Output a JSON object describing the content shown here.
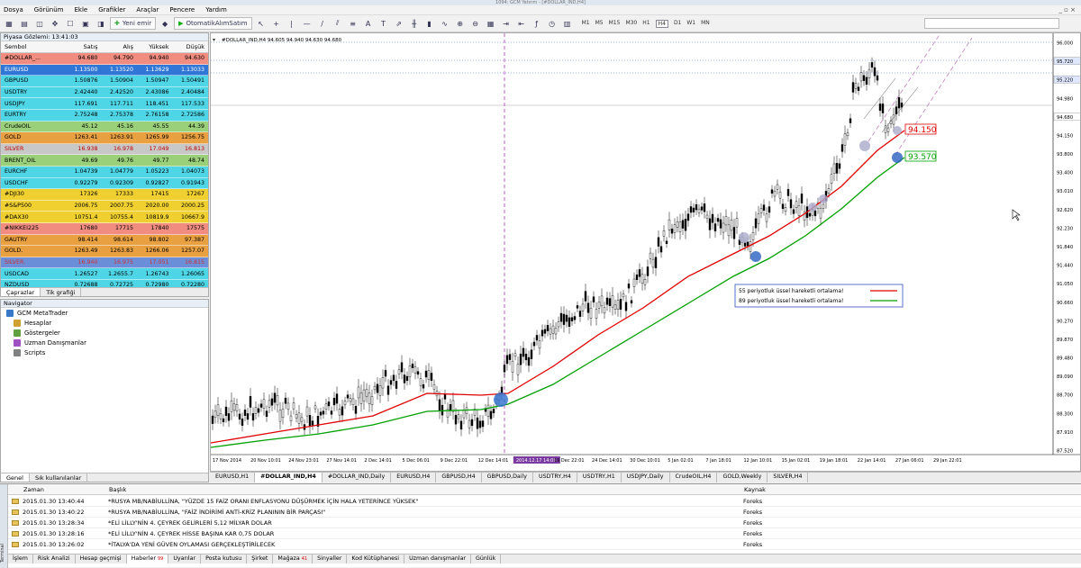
{
  "titlebar": "1094: GCM Yatırım - [#DOLLAR_IND,H4]",
  "menu": [
    "Dosya",
    "Görünüm",
    "Ekle",
    "Grafikler",
    "Araçlar",
    "Pencere",
    "Yardım"
  ],
  "toolbar": {
    "new_order": "Yeni emir",
    "auto_trading": "OtomatikAlımSatım",
    "timeframes": [
      "M1",
      "M5",
      "M15",
      "M30",
      "H1",
      "H4",
      "D1",
      "W1",
      "MN"
    ],
    "selected_tf": "H4"
  },
  "market_watch": {
    "title": "Piyasa Gözlemi: 13:41:03",
    "headers": [
      "Sembol",
      "Satış",
      "Alış",
      "Yüksek",
      "Düşük"
    ],
    "rows": [
      {
        "s": "#DOLLAR_...",
        "bid": "94.680",
        "ask": "94.790",
        "high": "94.940",
        "low": "94.630",
        "bg": "#f08c80"
      },
      {
        "s": "EURUSD",
        "bid": "1.13500",
        "ask": "1.13520",
        "high": "1.13629",
        "low": "1.13033",
        "bg": "#2f76d6",
        "fg": "#fff"
      },
      {
        "s": "GBPUSD",
        "bid": "1.50876",
        "ask": "1.50904",
        "high": "1.50947",
        "low": "1.50491",
        "bg": "#4ed6e6"
      },
      {
        "s": "USDTRY",
        "bid": "2.42440",
        "ask": "2.42520",
        "high": "2.43086",
        "low": "2.40484",
        "bg": "#4ed6e6"
      },
      {
        "s": "USDJPY",
        "bid": "117.691",
        "ask": "117.711",
        "high": "118.451",
        "low": "117.533",
        "bg": "#4ed6e6"
      },
      {
        "s": "EURTRY",
        "bid": "2.75248",
        "ask": "2.75378",
        "high": "2.76158",
        "low": "2.72586",
        "bg": "#4ed6e6"
      },
      {
        "s": "CrudeOIL",
        "bid": "45.12",
        "ask": "45.16",
        "high": "45.55",
        "low": "44.39",
        "bg": "#9ad07a"
      },
      {
        "s": "GOLD",
        "bid": "1263.41",
        "ask": "1263.91",
        "high": "1265.99",
        "low": "1256.75",
        "bg": "#e8a040"
      },
      {
        "s": "SILVER",
        "bid": "16.938",
        "ask": "16.978",
        "high": "17.049",
        "low": "16.813",
        "bg": "#c8c8c8",
        "fg": "#b00"
      },
      {
        "s": "BRENT_OIL",
        "bid": "49.69",
        "ask": "49.76",
        "high": "49.77",
        "low": "48.74",
        "bg": "#9ad07a"
      },
      {
        "s": "EURCHF",
        "bid": "1.04739",
        "ask": "1.04779",
        "high": "1.05223",
        "low": "1.04073",
        "bg": "#4ed6e6"
      },
      {
        "s": "USDCHF",
        "bid": "0.92279",
        "ask": "0.92309",
        "high": "0.92827",
        "low": "0.91943",
        "bg": "#4ed6e6"
      },
      {
        "s": "#DJI30",
        "bid": "17326",
        "ask": "17333",
        "high": "17415",
        "low": "17267",
        "bg": "#f0d030"
      },
      {
        "s": "#S&P500",
        "bid": "2006.75",
        "ask": "2007.75",
        "high": "2020.00",
        "low": "2000.25",
        "bg": "#f0d030"
      },
      {
        "s": "#DAX30",
        "bid": "10751.4",
        "ask": "10755.4",
        "high": "10819.9",
        "low": "10667.9",
        "bg": "#f0d030"
      },
      {
        "s": "#NIKKEI225",
        "bid": "17680",
        "ask": "17715",
        "high": "17840",
        "low": "17575",
        "bg": "#f08c80"
      },
      {
        "s": "GAUTRY",
        "bid": "98.414",
        "ask": "98.614",
        "high": "98.802",
        "low": "97.387",
        "bg": "#e8a040"
      },
      {
        "s": "GOLD.",
        "bid": "1263.49",
        "ask": "1263.83",
        "high": "1266.06",
        "low": "1257.07",
        "bg": "#e8a040"
      },
      {
        "s": "SILVER.",
        "bid": "16.940",
        "ask": "16.975",
        "high": "17.051",
        "low": "16.815",
        "bg": "#6a8fd8",
        "fg": "#d03030"
      },
      {
        "s": "USDCAD",
        "bid": "1.26527",
        "ask": "1.2655.7",
        "high": "1.26743",
        "low": "1.26065",
        "bg": "#4ed6e6"
      },
      {
        "s": "NZDUSD",
        "bid": "0.72688",
        "ask": "0.72725",
        "high": "0.72980",
        "low": "0.72280",
        "bg": "#4ed6e6"
      }
    ],
    "tabs": [
      "Çaprazlar",
      "Tik grafiği"
    ]
  },
  "navigator": {
    "title": "Navigator",
    "items": [
      "GCM MetaTrader",
      "Hesaplar",
      "Göstergeler",
      "Uzman Danışmanlar",
      "Scripts"
    ],
    "tabs": [
      "Genel",
      "Sık kullanılanlar"
    ]
  },
  "chart": {
    "header": "#DOLLAR_IND,H4  94.605 94.940 94.630 94.680",
    "price_ticks": [
      "96.000",
      "95.720",
      "95.220",
      "94.980",
      "94.680",
      "94.150",
      "93.800",
      "93.400",
      "93.010",
      "92.620",
      "92.230",
      "91.840",
      "91.440",
      "91.050",
      "90.660",
      "90.270",
      "89.870",
      "89.480",
      "89.090",
      "88.700",
      "88.300",
      "87.910",
      "87.520"
    ],
    "time_ticks": [
      "17 Nov 2014",
      "20 Nov 10:01",
      "24 Nov 23:01",
      "27 Nov 14:01",
      "2 Dec 14:01",
      "5 Dec 06:01",
      "9 Dec 22:01",
      "12 Dec 14:01",
      "2014.12.17 14:01",
      "19 Dec 22:01",
      "24 Dec 14:01",
      "30 Dec 10:01",
      "5 Jan 02:01",
      "7 Jan 18:01",
      "12 Jan 10:01",
      "15 Jan 02:01",
      "19 Jan 18:01",
      "22 Jan 14:01",
      "27 Jan 06:01",
      "29 Jan 22:01"
    ],
    "label_red": "94.150",
    "label_green": "93.570",
    "legend": [
      "55 periyotluk üssel hareketli ortalama!",
      "89 periyotluk üssel hareketli ortalama!"
    ],
    "colors": {
      "ema55": "#e00000",
      "ema89": "#00a000",
      "vline": "#c060c0",
      "channel": "#c080c0"
    }
  },
  "chart_tabs": [
    "EURUSD,H1",
    "#DOLLAR_IND,H4",
    "#DOLLAR_IND,Daily",
    "EURUSD,H4",
    "GBPUSD,H4",
    "GBPUSD,Daily",
    "USDTRY,H4",
    "USDTRY,H1",
    "USDJPY,Daily",
    "CrudeOIL,H4",
    "GOLD,Weekly",
    "SILVER,H4"
  ],
  "terminal": {
    "side": "Terminal",
    "headers": [
      "Zaman",
      "Başlık",
      "Kaynak"
    ],
    "rows": [
      {
        "t": "2015.01.30 13:40:44",
        "h": "*RUSYA MB/NABİULLİNA, \"YÜZDE 15 FAİZ ORANI ENFLASYONU DÜŞÜRMEK İÇİN HALA YETERİNCE YÜKSEK\"",
        "k": "Foreks"
      },
      {
        "t": "2015.01.30 13:40:22",
        "h": "*RUSYA MB/NABİULLİNA, \"FAİZ İNDİRİMİ ANTİ-KRİZ PLANININ BİR PARÇASI\"",
        "k": "Foreks"
      },
      {
        "t": "2015.01.30 13:28:34",
        "h": "*ELİ LİLLY'NİN 4. ÇEYREK GELİRLERİ 5,12 MİLYAR DOLAR",
        "k": "Foreks"
      },
      {
        "t": "2015.01.30 13:28:16",
        "h": "*ELİ LİLLY'NİN 4. ÇEYREK HİSSE BAŞINA KAR 0,75 DOLAR",
        "k": "Foreks"
      },
      {
        "t": "2015.01.30 13:26:02",
        "h": "*İTALYA'DA YENİ GÜVEN OYLAMASI GERÇEKLEŞTİRİLECEK",
        "k": "Foreks"
      }
    ],
    "tabs": [
      "İşlem",
      "Risk Analizi",
      "Hesap geçmişi",
      "Haberler",
      "Uyarılar",
      "Posta kutusu",
      "Şirket",
      "Mağaza",
      "Sinyaller",
      "Kod Kütüphanesi",
      "Uzman danışmanlar",
      "Günlük"
    ],
    "tab_badges": {
      "Haberler": "99",
      "Mağaza": "41"
    }
  }
}
